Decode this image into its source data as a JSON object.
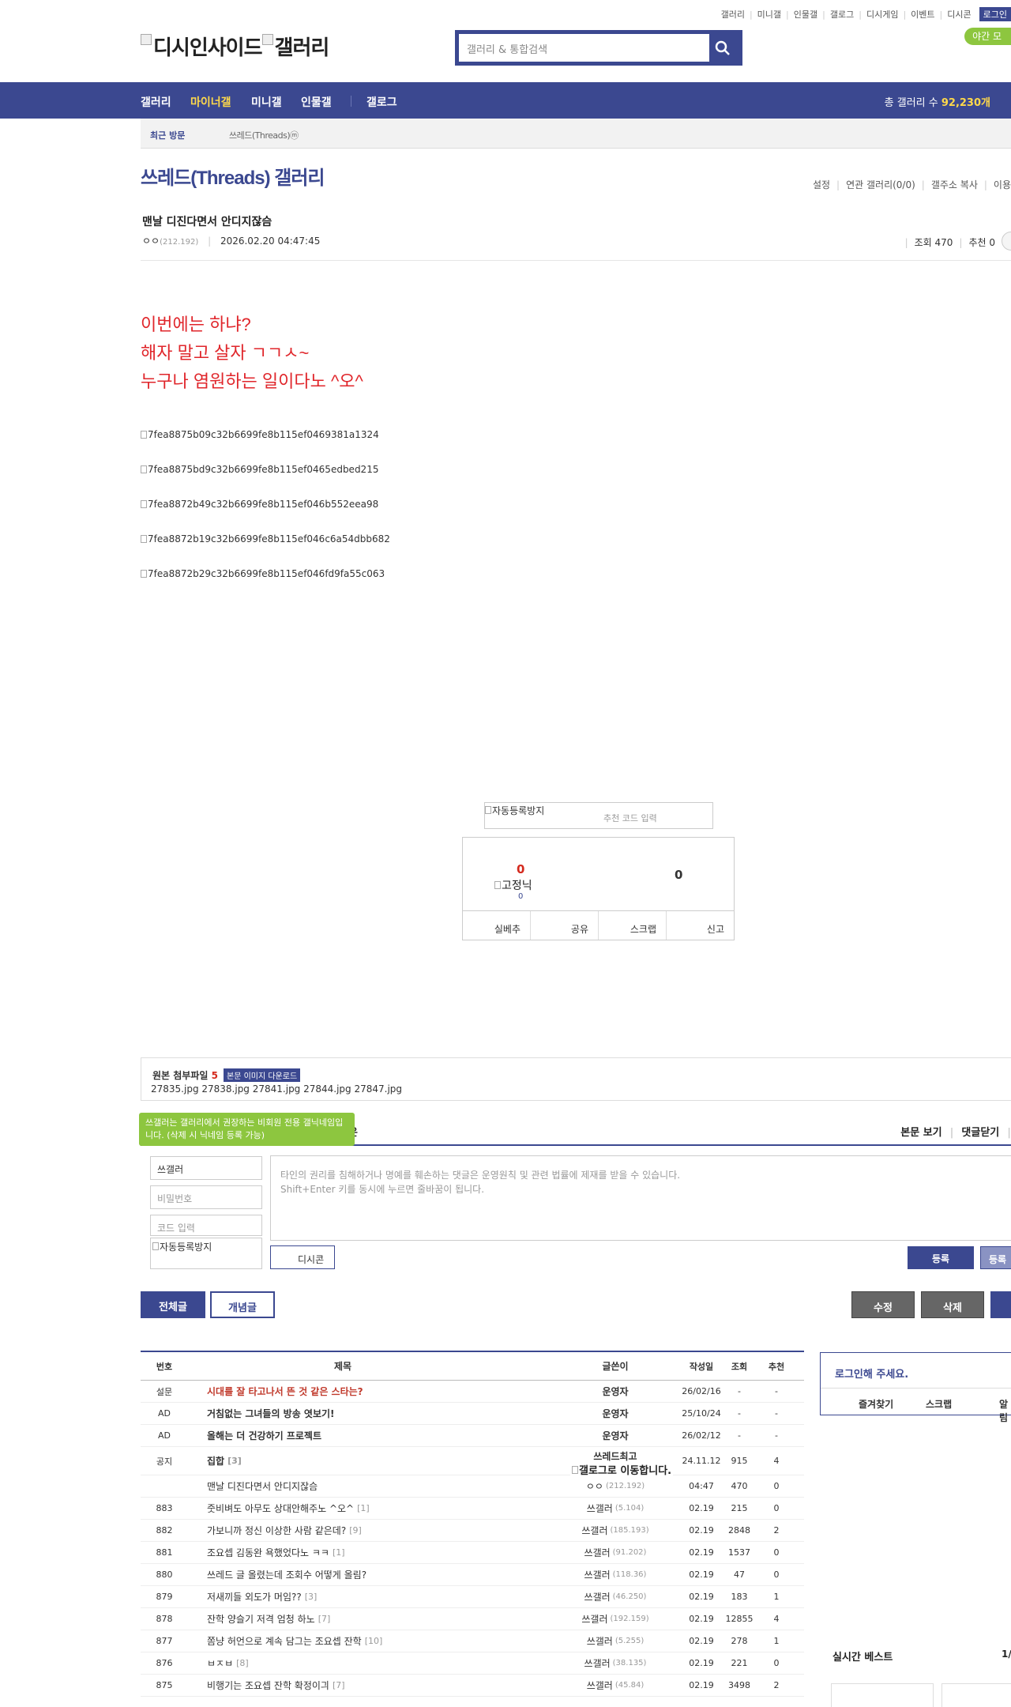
{
  "header": {
    "top_links": [
      "갤러리",
      "미니갤",
      "인물갤",
      "갤로그",
      "디시게임",
      "이벤트",
      "디시콘"
    ],
    "login": "로그인",
    "night_mode": "야간 모",
    "logo_alt_1": "디시인사이드",
    "logo_alt_2": "갤러리",
    "search_placeholder": "갤러리 & 통합검색"
  },
  "gnb": {
    "items": [
      "갤러리",
      "마이너갤",
      "미니갤",
      "인물갤",
      "갤로그"
    ],
    "active_index": 1,
    "total_label": "총 갤러리 수",
    "total_value": "92,230개"
  },
  "recent": {
    "label": "최근 방문",
    "items": [
      "쓰레드(Threads)ⓜ"
    ]
  },
  "gallery": {
    "title": "쓰레드(Threads) 갤러리",
    "menu": [
      "설정",
      "연관 갤러리(0/0)",
      "갤주소 복사",
      "이용"
    ]
  },
  "post": {
    "title": "맨날 디진다면서 안디지잖슴",
    "author": "ㅇㅇ",
    "ip": "(212.192)",
    "datetime": "2026.02.20 04:47:45",
    "views": "조회 470",
    "recommend": "추천 0",
    "body_lines": [
      "이번에는 하냐?",
      "해자 말고 살자 ㄱㄱㅅ~",
      "누구나 염원하는 일이다노 ^오^"
    ],
    "images": [
      "7fea8875b09c32b6699fe8b115ef0469381a1324",
      "7fea8875bd9c32b6699fe8b115ef0465edbed215",
      "7fea8872b49c32b6699fe8b115ef046b552eea98",
      "7fea8872b19c32b6699fe8b115ef046c6a54dbb682",
      "7fea8872b29c32b6699fe8b115ef046fd9fa55c063"
    ]
  },
  "vote": {
    "captcha_alt": "자동등록방지",
    "code_placeholder": "추천 코드 입력",
    "up_count": "0",
    "down_count": "0",
    "fixed_nick_alt": "고정닉",
    "fixed_nick_count": "0",
    "buttons": [
      "실베추",
      "공유",
      "스크랩",
      "신고"
    ]
  },
  "attachments": {
    "label": "원본 첨부파일",
    "count": "5",
    "download_label": "본문 이미지 다운로드",
    "files": "27835.jpg  27838.jpg  27841.jpg  27844.jpg  27847.jpg"
  },
  "comment": {
    "tip": "쓰갤러는 갤러리에서 권장하는 비회원 전용 갤닉네임입니다. (삭제 시 닉네임 등록 가능)",
    "tip_tail": "은",
    "links": [
      "본문 보기",
      "댓글닫기"
    ],
    "nickname": "쓰갤러",
    "password_placeholder": "비밀번호",
    "code_placeholder": "코드 입력",
    "captcha_alt": "자동등록방지",
    "textarea_line1": "타인의 권리를 침해하거나 명예를 훼손하는 댓글은 운영원칙 및 관련 법률에 제재를 받을 수 있습니다.",
    "textarea_line2": "Shift+Enter 키를 동시에 누르면 줄바꿈이 됩니다.",
    "dccon": "디시콘",
    "submit": "등록",
    "submit2": "등록"
  },
  "list_buttons": {
    "all": "전체글",
    "concept": "개념글",
    "edit": "수정",
    "delete": "삭제"
  },
  "table": {
    "headers": [
      "번호",
      "제목",
      "글쓴이",
      "작성일",
      "조회",
      "추천"
    ],
    "rows": [
      {
        "num": "설문",
        "subject": "시대를 잘 타고나서 뜬 것 같은 스타는?",
        "cnt": "",
        "writer": "운영자",
        "ip": "",
        "date": "26/02/16",
        "hit": "-",
        "rec": "-",
        "style": "survey"
      },
      {
        "num": "AD",
        "subject": "거침없는 그녀들의 방송 엿보기!",
        "cnt": "",
        "writer": "운영자",
        "ip": "",
        "date": "25/10/24",
        "hit": "-",
        "rec": "-",
        "style": "bold"
      },
      {
        "num": "AD",
        "subject": "올해는 더 건강하기 프로젝트",
        "cnt": "",
        "writer": "운영자",
        "ip": "",
        "date": "26/02/12",
        "hit": "-",
        "rec": "-",
        "style": "bold"
      },
      {
        "num": "공지",
        "subject": "집합",
        "cnt": "[3]",
        "writer": "쓰레드최고",
        "ip": "",
        "date": "24.11.12",
        "hit": "915",
        "rec": "4",
        "style": "notice"
      },
      {
        "num": "",
        "subject": "맨날 디진다면서 안디지잖슴",
        "cnt": "",
        "writer": "ㅇㅇ",
        "ip": "(212.192)",
        "date": "04:47",
        "hit": "470",
        "rec": "0",
        "style": "current"
      },
      {
        "num": "883",
        "subject": "줏비벼도 아무도 상대안해주노 ^오^",
        "cnt": "[1]",
        "writer": "쓰갤러",
        "ip": "(5.104)",
        "date": "02.19",
        "hit": "215",
        "rec": "0",
        "style": ""
      },
      {
        "num": "882",
        "subject": "가보니까 정신 이상한 사람 같은데?",
        "cnt": "[9]",
        "writer": "쓰갤러",
        "ip": "(185.193)",
        "date": "02.19",
        "hit": "2848",
        "rec": "2",
        "style": ""
      },
      {
        "num": "881",
        "subject": "조요셉 김동완 욕했었다노 ㅋㅋ",
        "cnt": "[1]",
        "writer": "쓰갤러",
        "ip": "(91.202)",
        "date": "02.19",
        "hit": "1537",
        "rec": "0",
        "style": ""
      },
      {
        "num": "880",
        "subject": "쓰레드 글 올렸는데 조회수 어떻게 올림?",
        "cnt": "",
        "writer": "쓰갤러",
        "ip": "(118.36)",
        "date": "02.19",
        "hit": "47",
        "rec": "0",
        "style": ""
      },
      {
        "num": "879",
        "subject": "저새끼들 외도가 머임??",
        "cnt": "[3]",
        "writer": "쓰갤러",
        "ip": "(46.250)",
        "date": "02.19",
        "hit": "183",
        "rec": "1",
        "style": ""
      },
      {
        "num": "878",
        "subject": "잔학 양슬기 저격 엄청 하노",
        "cnt": "[7]",
        "writer": "쓰갤러",
        "ip": "(192.159)",
        "date": "02.19",
        "hit": "12855",
        "rec": "4",
        "style": ""
      },
      {
        "num": "877",
        "subject": "쫌냥 허언으로 계속 담그는 조요셉 잔학",
        "cnt": "[10]",
        "writer": "쓰갤러",
        "ip": "(5.255)",
        "date": "02.19",
        "hit": "278",
        "rec": "1",
        "style": ""
      },
      {
        "num": "876",
        "subject": "ㅂㅈㅂ",
        "cnt": "[8]",
        "writer": "쓰갤러",
        "ip": "(38.135)",
        "date": "02.19",
        "hit": "221",
        "rec": "0",
        "style": ""
      },
      {
        "num": "875",
        "subject": "비행기는 조요셉 잔학 확정이긔",
        "cnt": "[7]",
        "writer": "쓰갤러",
        "ip": "(45.84)",
        "date": "02.19",
        "hit": "3498",
        "rec": "2",
        "style": ""
      }
    ]
  },
  "notice_overlay": "갤로그로 이동합니다.",
  "side": {
    "login_prompt": "로그인해 주세요.",
    "links": [
      "즐겨찾기",
      "스크랩",
      "알림"
    ],
    "best_title": "실시간 베스트",
    "best_page": "1/"
  }
}
